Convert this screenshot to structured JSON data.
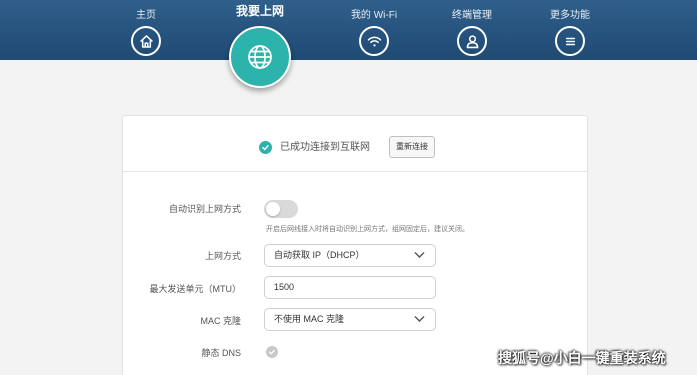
{
  "nav": {
    "items": [
      {
        "label": "主页",
        "icon": "home-icon"
      },
      {
        "label": "我要上网",
        "icon": "globe-icon",
        "active": true
      },
      {
        "label": "我的 Wi-Fi",
        "icon": "wifi-icon"
      },
      {
        "label": "终端管理",
        "icon": "user-icon"
      },
      {
        "label": "更多功能",
        "icon": "menu-icon"
      }
    ]
  },
  "status": {
    "text": "已成功连接到互联网",
    "reconnect_label": "重新连接"
  },
  "form": {
    "auto_detect_label": "自动识别上网方式",
    "auto_detect_hint": "开启后网线接入时将自动识别上网方式，组网固定后，建议关闭。",
    "auto_detect_on": false,
    "connection_type_label": "上网方式",
    "connection_type_value": "自动获取 IP（DHCP）",
    "mtu_label": "最大发送单元（MTU）",
    "mtu_value": "1500",
    "mac_clone_label": "MAC 克隆",
    "mac_clone_value": "不使用 MAC 克隆",
    "static_dns_label": "静态 DNS",
    "static_dns_on": false
  },
  "watermark": "搜狐号@小白一键重装系统",
  "colors": {
    "nav_bg": "#264f78",
    "accent": "#2cb3ac",
    "page_bg": "#f3f3f3"
  }
}
